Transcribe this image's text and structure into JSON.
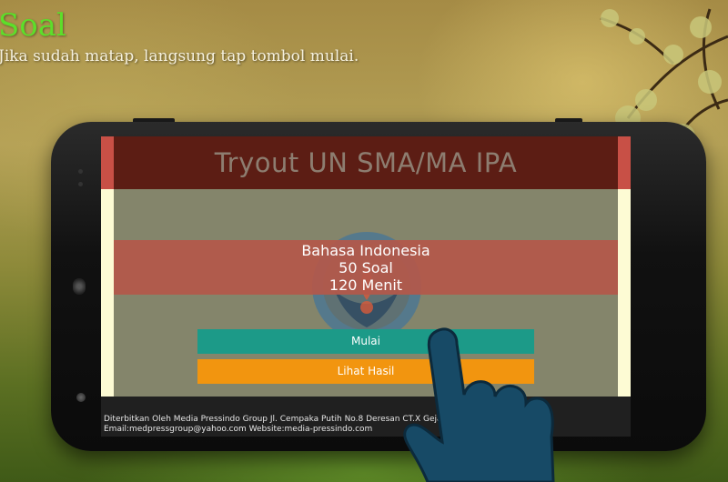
{
  "page": {
    "heading": "Soal",
    "instruction": "Jika sudah matap, langsung tap tombol mulai."
  },
  "app": {
    "title": "Tryout UN SMA/MA IPA",
    "subject": "Bahasa Indonesia",
    "question_count": "50 Soal",
    "duration": "120 Menit",
    "start_button": "Mulai",
    "results_button": "Lihat Hasil",
    "footer_line1": "Diterbitkan Oleh Media Pressindo Group Jl. Cempaka Putih No.8 Deresan CT.X Gejayan Yogyakarta",
    "footer_line2": "Email:medpressgroup@yahoo.com Website:media-pressindo.com"
  },
  "icons": {
    "logo": "tut-wuri-handayani-logo",
    "hand": "pointing-hand-icon"
  },
  "colors": {
    "heading": "#5dde2a",
    "title_bar": "#c85046",
    "start_button": "#1c9a88",
    "results_button": "#f2950f",
    "screen_background": "#fdfbd4"
  }
}
